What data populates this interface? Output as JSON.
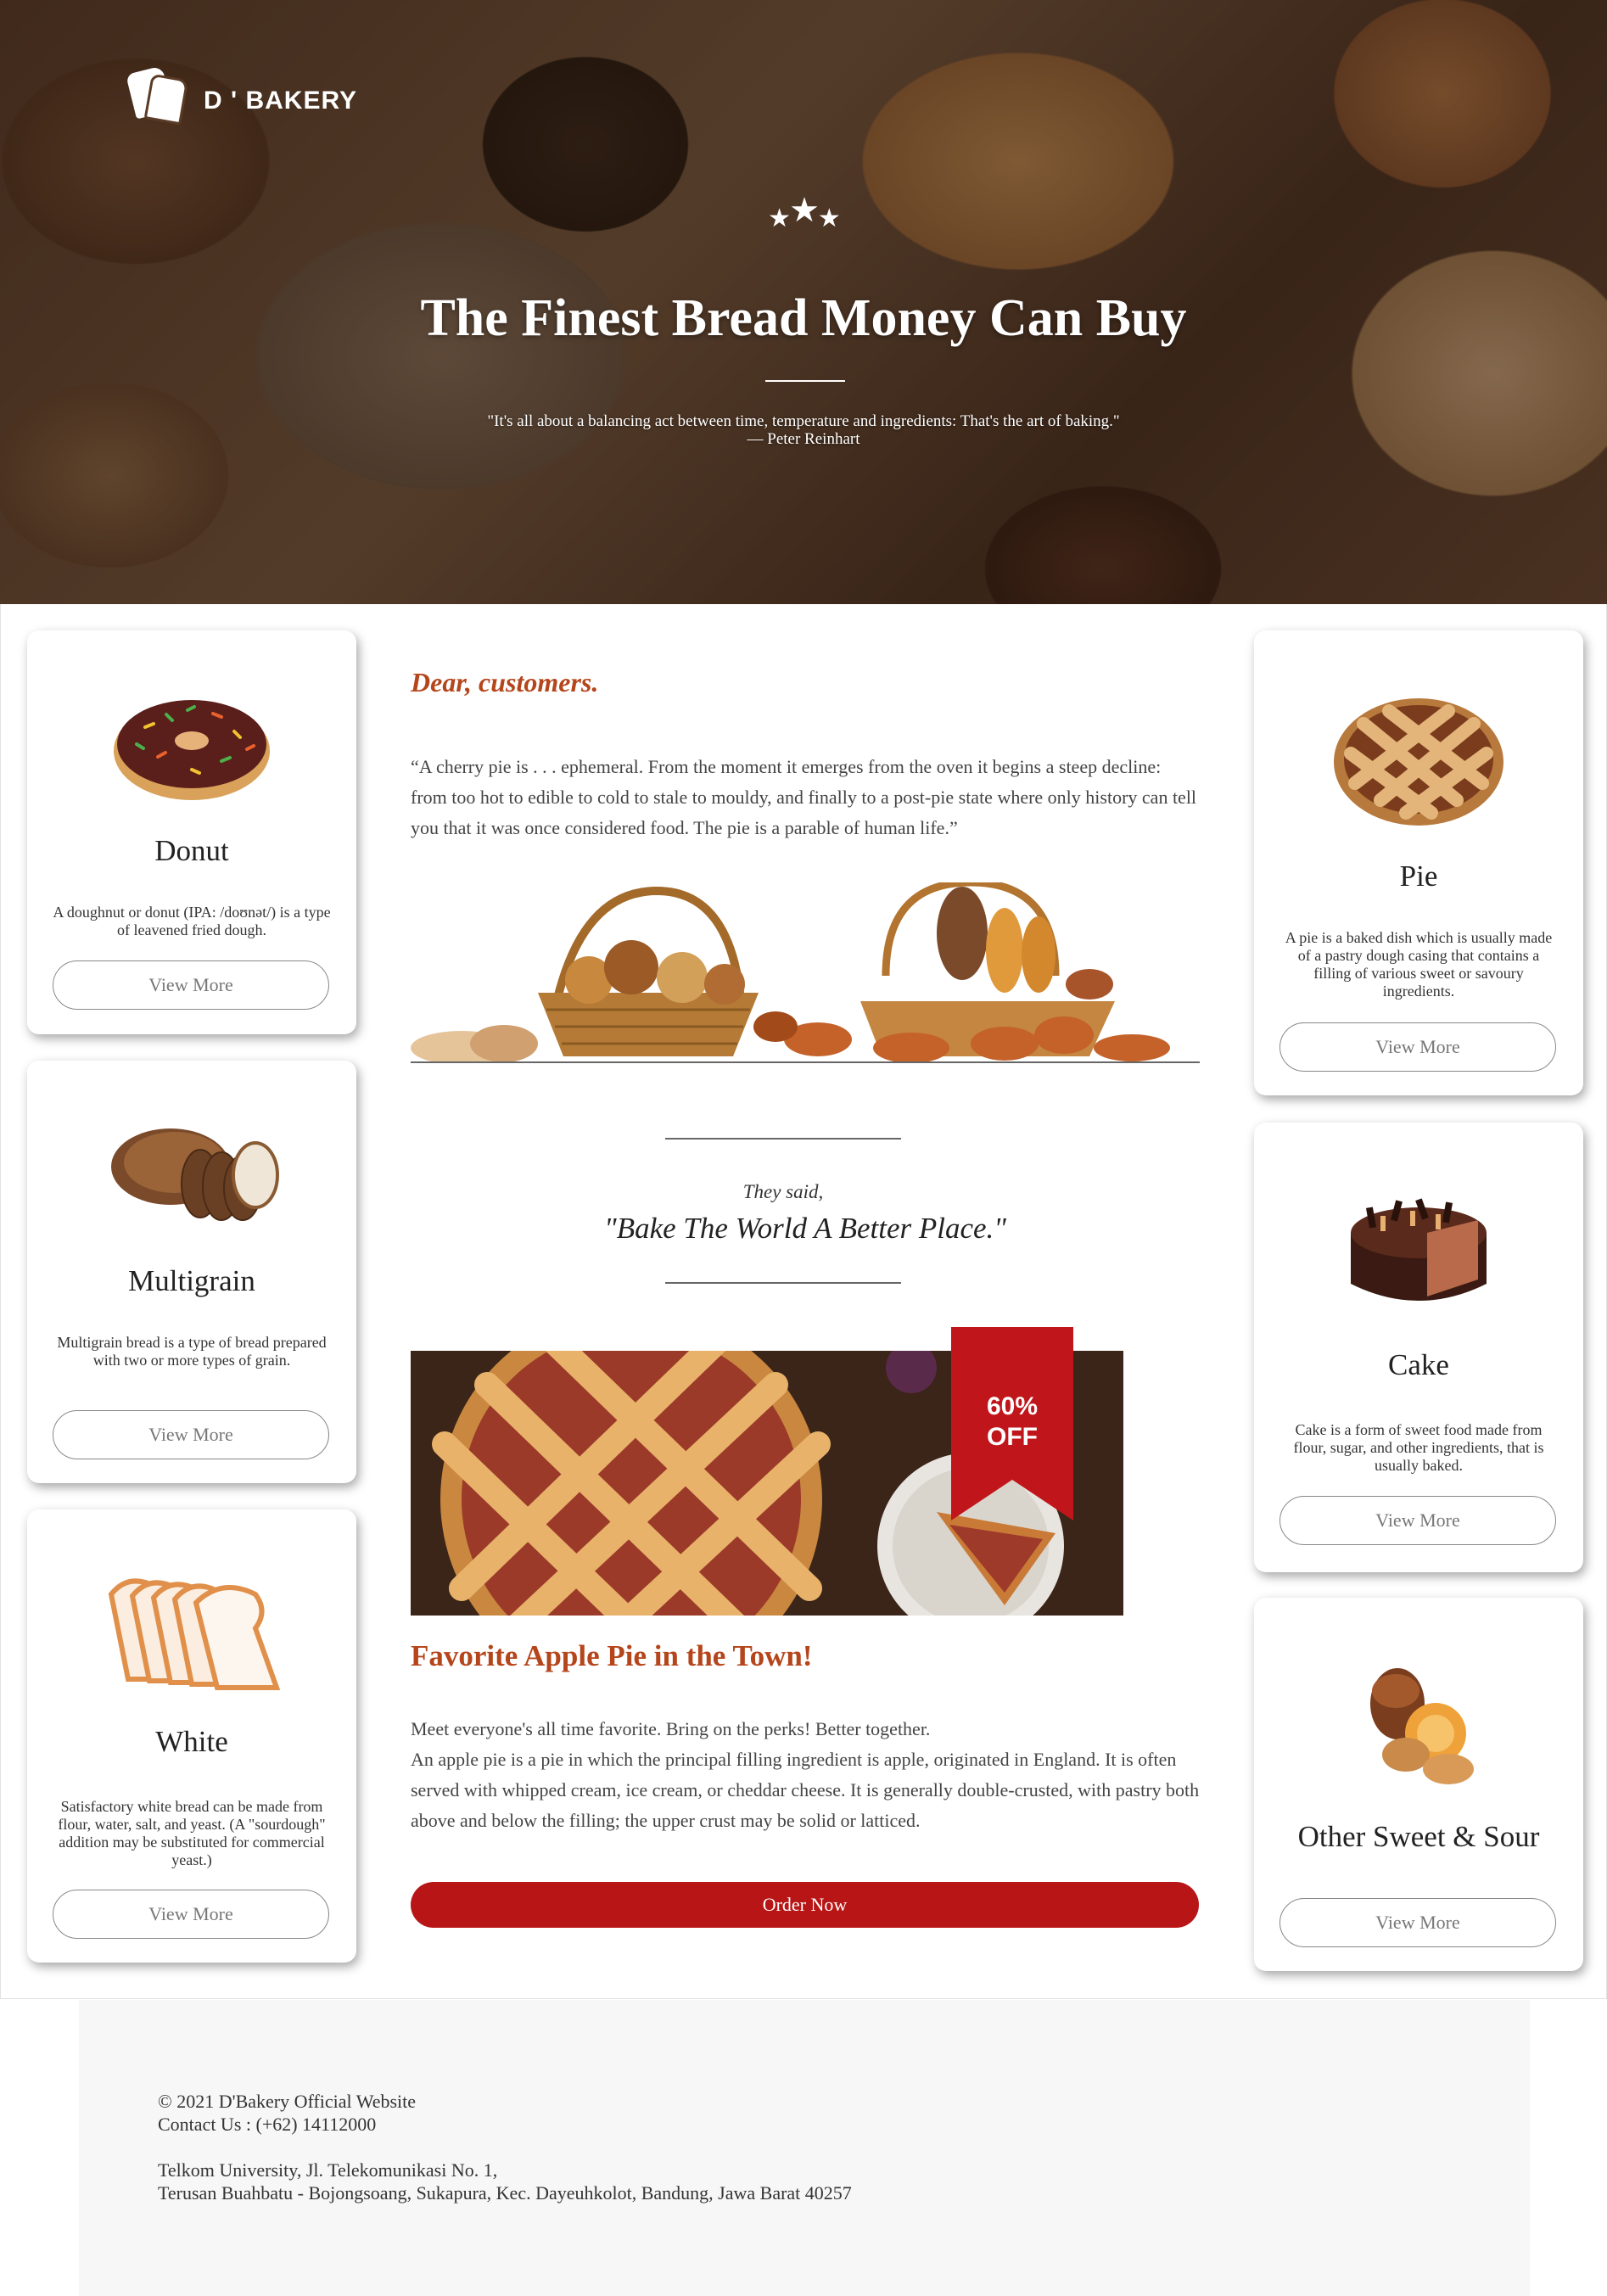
{
  "brand": {
    "name": "D ' BAKERY"
  },
  "hero": {
    "title": "The Finest Bread Money Can Buy",
    "quote": "\"It's all about a balancing act between time, temperature and ingredients: That's the art of baking.\"",
    "author": "— Peter Reinhart",
    "stars": "★★★"
  },
  "left_cards": [
    {
      "title": "Donut",
      "description": "A doughnut or donut (IPA: /doʊnət/) is a type of leavened fried dough.",
      "button": "View More",
      "icon": "donut-icon"
    },
    {
      "title": "Multigrain",
      "description": "Multigrain bread is a type of bread prepared with two or more types of grain.",
      "button": "View More",
      "icon": "multigrain-bread-icon"
    },
    {
      "title": "White",
      "description": "Satisfactory white bread can be made from flour, water, salt, and yeast. (A \"sourdough\" addition may be substituted for commercial yeast.)",
      "button": "View More",
      "icon": "white-bread-icon"
    }
  ],
  "right_cards": [
    {
      "title": "Pie",
      "description": "A pie is a baked dish which is usually made of a pastry dough casing that contains a filling of various sweet or savoury ingredients.",
      "button": "View More",
      "icon": "pie-icon"
    },
    {
      "title": "Cake",
      "description": "Cake is a form of sweet food made from flour, sugar, and other ingredients, that is usually baked.",
      "button": "View More",
      "icon": "cake-icon"
    },
    {
      "title": "Other Sweet & Sour",
      "description": "",
      "button": "View More",
      "icon": "pastries-icon"
    }
  ],
  "main": {
    "greeting": "Dear, customers.",
    "quote": "“A cherry pie is . . . ephemeral. From the moment it emerges from the oven it begins a steep decline: from too hot to edible to cold to stale to mouldy, and finally to a post-pie state where only history can tell you that it was once considered food. The pie is a parable of human life.”",
    "said_label": "They said,",
    "said_quote": "\"Bake The World A Better Place.\"",
    "promo_badge": "60% OFF",
    "promo_badge_line1": "60%",
    "promo_badge_line2": "OFF",
    "feature_title": "Favorite Apple Pie in the Town!",
    "feature_line1": "Meet everyone's all time favorite. Bring on the perks! Better together.",
    "feature_line2": "An apple pie is a pie in which the principal filling ingredient is apple, originated in England. It is often served with whipped cream, ice cream, or cheddar cheese. It is generally double-crusted, with pastry both above and below the filling; the upper crust may be solid or latticed.",
    "order_button": "Order Now"
  },
  "footer": {
    "copyright": "© 2021 D'Bakery Official Website",
    "contact": "Contact Us : (+62) 14112000",
    "address_line1": "Telkom University, Jl. Telekomunikasi No. 1,",
    "address_line2": "Terusan Buahbatu - Bojongsoang, Sukapura, Kec. Dayeuhkolot, Bandung, Jawa Barat 40257"
  },
  "colors": {
    "accent_orange": "#b5451b",
    "button_red": "#b81616",
    "ribbon_red": "#c0161b"
  }
}
